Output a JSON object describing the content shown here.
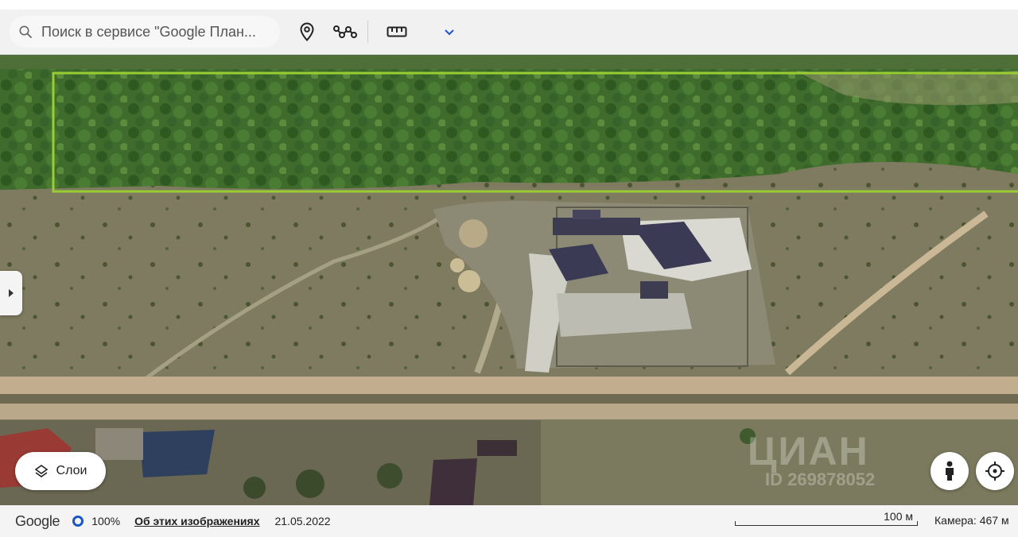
{
  "search": {
    "placeholder": "Поиск в сервисе \"Google План..."
  },
  "toolbar": {
    "icons": [
      "search-icon",
      "pin-icon",
      "path-icon",
      "ruler-icon",
      "chevron-down-icon"
    ]
  },
  "map": {
    "layers_label": "Слои",
    "watermark": "ЦИАН",
    "watermark_id": "ID 269878052",
    "highlight_color": "#9acd32"
  },
  "footer": {
    "logo": "Google",
    "zoom": "100%",
    "about": "Об этих изображениях",
    "date": "21.05.2022",
    "scale": "100 м",
    "camera": "Камера: 467 м"
  },
  "colors": {
    "zoom_ring": "#1a56c9",
    "toolbar_bg": "#f1f1f1"
  }
}
